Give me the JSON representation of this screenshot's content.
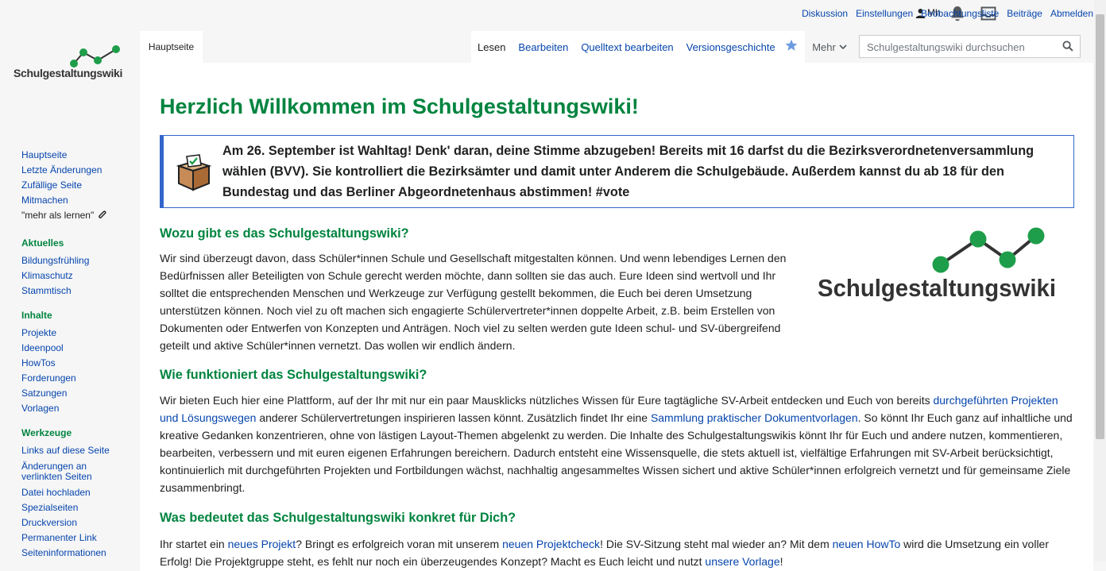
{
  "personal": {
    "username": "Mh",
    "links": [
      "Diskussion",
      "Einstellungen",
      "Beobachtungsliste",
      "Beiträge",
      "Abmelden"
    ]
  },
  "logo": {
    "text": "Schulgestaltungswiki"
  },
  "tabs": {
    "main": "Hauptseite",
    "actions": [
      "Lesen",
      "Bearbeiten",
      "Quelltext bearbeiten",
      "Versionsgeschichte"
    ],
    "more": "Mehr"
  },
  "search": {
    "placeholder": "Schulgestaltungswiki durchsuchen",
    "value": ""
  },
  "sidebar": {
    "nav": [
      "Hauptseite",
      "Letzte Änderungen",
      "Zufällige Seite",
      "Mitmachen",
      "\"mehr als lernen\""
    ],
    "aktuelles": {
      "heading": "Aktuelles",
      "items": [
        "Bildungsfrühling",
        "Klimaschutz",
        "Stammtisch"
      ]
    },
    "inhalte": {
      "heading": "Inhalte",
      "items": [
        "Projekte",
        "Ideenpool",
        "HowTos",
        "Forderungen",
        "Satzungen",
        "Vorlagen"
      ]
    },
    "werkzeuge": {
      "heading": "Werkzeuge",
      "items": [
        "Links auf diese Seite",
        "Änderungen an verlinkten Seiten",
        "Datei hochladen",
        "Spezialseiten",
        "Druckversion",
        "Permanenter Link",
        "Seiteninformationen"
      ]
    }
  },
  "content": {
    "title": "Herzlich Willkommen im Schulgestaltungswiki!",
    "notice": "Am 26. September ist Wahltag! Denk' daran, deine Stimme abzugeben! Bereits mit 16 darfst du die Bezirksverordnetenversammlung wählen (BVV). Sie kontrolliert die Bezirksämter und damit unter Anderem die Schulgebäude. Außerdem kannst du ab 18 für den Bundestag und das Berliner Abgeordnetenhaus abstimmen! #vote",
    "section1": {
      "heading": "Wozu gibt es das Schulgestaltungswiki?",
      "text": "Wir sind überzeugt davon, dass Schüler*innen Schule und Gesellschaft mitgestalten können. Und wenn lebendiges Lernen den Bedürfnissen aller Beteiligten von Schule gerecht werden möchte, dann sollten sie das auch. Eure Ideen sind wertvoll und Ihr solltet die entsprechenden Menschen und Werkzeuge zur Verfügung gestellt bekommen, die Euch bei deren Umsetzung unterstützen können. Noch viel zu oft machen sich engagierte Schülervertreter*innen doppelte Arbeit, z.B. beim Erstellen von Dokumenten oder Entwerfen von Konzepten und Anträgen. Noch viel zu selten werden gute Ideen schul- und SV-übergreifend geteilt und aktive Schüler*innen vernetzt. Das wollen wir endlich ändern."
    },
    "section2": {
      "heading": "Wie funktioniert das Schulgestaltungswiki?",
      "t1": "Wir bieten Euch hier eine Plattform, auf der Ihr mit nur ein paar Mausklicks nützliches Wissen für Eure tagtägliche SV-Arbeit entdecken und Euch von bereits ",
      "l1": "durchgeführten Projekten und Lösungswegen",
      "t2": " anderer Schülervertretungen inspirieren lassen könnt. Zusätzlich findet Ihr eine ",
      "l2": "Sammlung praktischer Dokumentvorlagen",
      "t3": ". So könnt Ihr Euch ganz auf inhaltliche und kreative Gedanken konzentrieren, ohne von lästigen Layout-Themen abgelenkt zu werden. Die Inhalte des Schulgestaltungswikis könnt Ihr für Euch und andere nutzen, kommentieren, bearbeiten, verbessern und mit euren eigenen Erfahrungen bereichern. Dadurch entsteht eine Wissensquelle, die stets aktuell ist, vielfältige Erfahrungen mit SV-Arbeit berücksichtigt, kontinuierlich mit durchgeführten Projekten und Fortbildungen wächst, nachhaltig angesammeltes Wissen sichert und aktive Schüler*innen erfolgreich vernetzt und für gemeinsame Ziele zusammenbringt."
    },
    "section3": {
      "heading": "Was bedeutet das Schulgestaltungswiki konkret für Dich?",
      "t1": "Ihr startet ein ",
      "l1": "neues Projekt",
      "t2": "? Bringt es erfolgreich voran mit unserem ",
      "l2": "neuen Projektcheck",
      "t3": "! Die SV-Sitzung steht mal wieder an? Mit dem ",
      "l3": "neuen HowTo",
      "t4": " wird die Umsetzung ein voller Erfolg! Die Projektgruppe steht, es fehlt nur noch ein überzeugendes Konzept? Macht es Euch leicht und nutzt ",
      "l4": "unsere Vorlage",
      "t5": "!"
    }
  },
  "colors": {
    "accent_green": "#00843f",
    "link_blue": "#0645ad",
    "notice_border": "#3366cc",
    "logo_dot": "#1e9e4a"
  },
  "icons": {
    "user": "user-icon",
    "bell": "bell-icon",
    "inbox": "inbox-icon",
    "star": "star-icon",
    "search": "search-icon",
    "ballot": "ballot-box-icon",
    "chevron": "chevron-down-icon",
    "paperclip": "paperclip-icon"
  }
}
